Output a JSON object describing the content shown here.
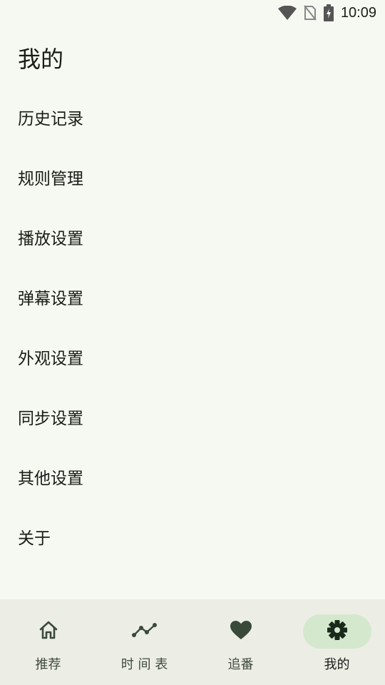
{
  "status_bar": {
    "time": "10:09",
    "icons": [
      "wifi-icon",
      "no-sim-icon",
      "battery-charging-icon"
    ]
  },
  "page": {
    "title": "我的"
  },
  "menu": {
    "items": [
      {
        "label": "历史记录"
      },
      {
        "label": "规则管理"
      },
      {
        "label": "播放设置"
      },
      {
        "label": "弹幕设置"
      },
      {
        "label": "外观设置"
      },
      {
        "label": "同步设置"
      },
      {
        "label": "其他设置"
      },
      {
        "label": "关于"
      }
    ]
  },
  "bottom_nav": {
    "items": [
      {
        "label": "推荐",
        "icon": "home-icon"
      },
      {
        "label": "时 间 表",
        "icon": "timeline-icon"
      },
      {
        "label": "追番",
        "icon": "heart-icon"
      },
      {
        "label": "我的",
        "icon": "gear-icon",
        "active": true
      }
    ]
  },
  "colors": {
    "background": "#f6f9f1",
    "nav_background": "#eceee6",
    "active_indicator": "#d4e8cd",
    "icon": "#3a4a3a"
  }
}
